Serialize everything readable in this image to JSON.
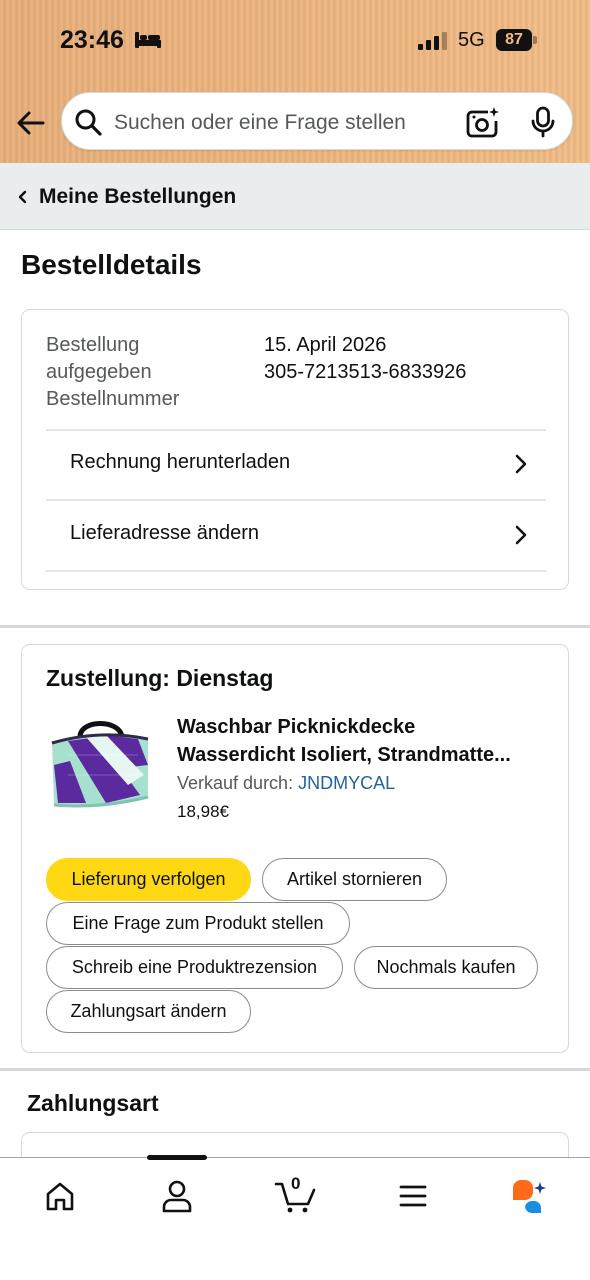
{
  "status_bar": {
    "time": "23:46",
    "network": "5G",
    "battery": "87"
  },
  "search": {
    "placeholder": "Suchen oder eine Frage stellen"
  },
  "breadcrumb": {
    "label": "Meine Bestellungen"
  },
  "page": {
    "title": "Bestelldetails"
  },
  "order": {
    "placed_label": "Bestellung aufgegeben",
    "number_label": "Bestellnummer",
    "placed_value": "15. April 2026",
    "number_value": "305-7213513-6833926",
    "links": [
      {
        "label": "Rechnung herunterladen"
      },
      {
        "label": "Lieferadresse ändern"
      }
    ]
  },
  "delivery": {
    "heading": "Zustellung: Dienstag",
    "product": {
      "title_line1": "Waschbar Picknickdecke",
      "title_line2": "Wasserdicht Isoliert, Strandmatte...",
      "seller_prefix": "Verkauf durch:",
      "seller_name": "JNDMYCAL",
      "price": "18,98€"
    },
    "actions": [
      {
        "label": "Lieferung verfolgen",
        "primary": true
      },
      {
        "label": "Artikel stornieren"
      },
      {
        "label": "Eine Frage zum Produkt stellen"
      },
      {
        "label": "Schreib eine Produktrezension"
      },
      {
        "label": "Nochmals kaufen"
      },
      {
        "label": "Zahlungsart ändern"
      }
    ]
  },
  "payment": {
    "title": "Zahlungsart"
  },
  "bottom_nav": {
    "cart_count": "0",
    "items": [
      "home-icon",
      "account-icon",
      "cart-icon",
      "menu-icon",
      "rufus-ai-icon"
    ]
  },
  "colors": {
    "header_bg": "#f0bb85",
    "primary_button": "#ffd814",
    "link": "#2162a1",
    "breadcrumb_bg": "#eaeded"
  }
}
